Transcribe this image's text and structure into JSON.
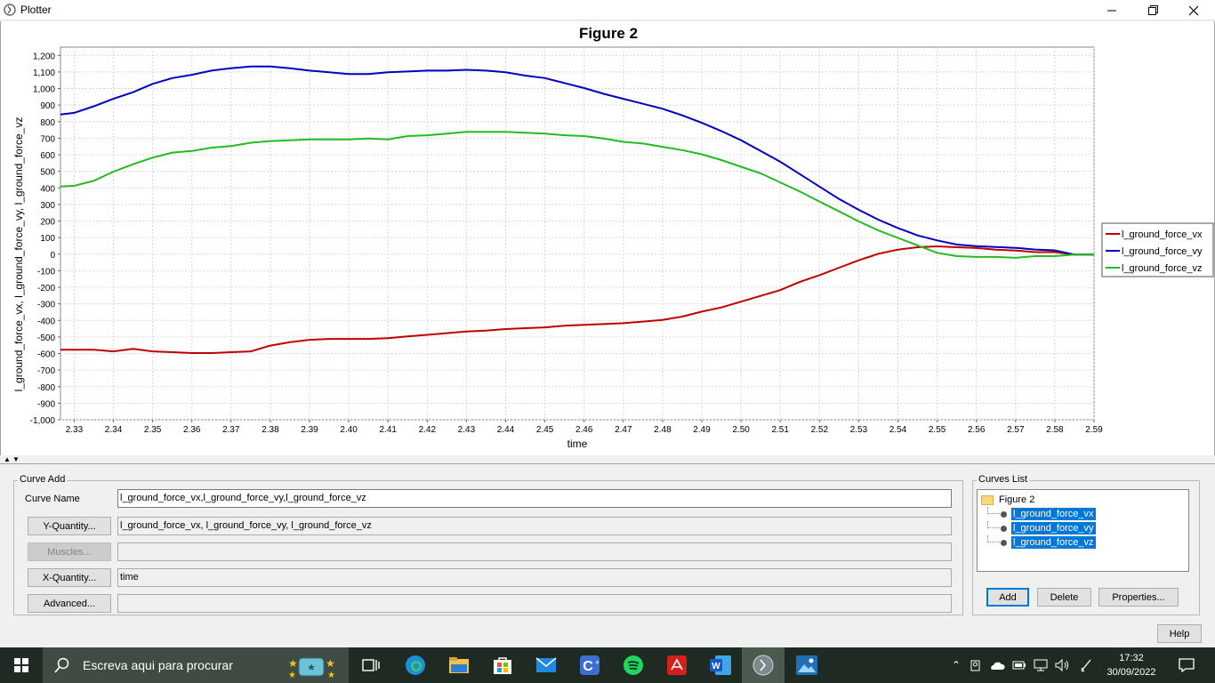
{
  "window": {
    "title": "Plotter"
  },
  "chart": {
    "title": "Figure 2",
    "xlabel": "time",
    "ylabel": "l_ground_force_vx, l_ground_force_vy, l_ground_force_vz",
    "legend": [
      "l_ground_force_vx",
      "l_ground_force_vy",
      "l_ground_force_vz"
    ],
    "colors": {
      "vx": "#c00000",
      "vy": "#0000c0",
      "vz": "#22bb22"
    }
  },
  "chart_data": {
    "type": "line",
    "title": "Figure 2",
    "xlabel": "time",
    "ylabel": "l_ground_force_vx, l_ground_force_vy, l_ground_force_vz",
    "xlim": [
      2.3265,
      2.59
    ],
    "ylim": [
      -1000,
      1250
    ],
    "grid": true,
    "legend_position": "right",
    "x_ticks": [
      "2.33",
      "2.34",
      "2.35",
      "2.36",
      "2.37",
      "2.38",
      "2.39",
      "2.40",
      "2.41",
      "2.42",
      "2.43",
      "2.44",
      "2.45",
      "2.46",
      "2.47",
      "2.48",
      "2.49",
      "2.50",
      "2.51",
      "2.52",
      "2.53",
      "2.54",
      "2.55",
      "2.56",
      "2.57",
      "2.58",
      "2.59"
    ],
    "y_ticks": [
      "1,200",
      "1,100",
      "1,000",
      "900",
      "800",
      "700",
      "600",
      "500",
      "400",
      "300",
      "200",
      "100",
      "0",
      "-100",
      "-200",
      "-300",
      "-400",
      "-500",
      "-600",
      "-700",
      "-800",
      "-900",
      "-1,000"
    ],
    "series": [
      {
        "name": "l_ground_force_vx",
        "color": "#c00000",
        "x": [
          2.3265,
          2.33,
          2.335,
          2.34,
          2.345,
          2.35,
          2.355,
          2.36,
          2.365,
          2.37,
          2.375,
          2.38,
          2.385,
          2.39,
          2.395,
          2.4,
          2.405,
          2.41,
          2.415,
          2.42,
          2.425,
          2.43,
          2.435,
          2.44,
          2.445,
          2.45,
          2.455,
          2.46,
          2.465,
          2.47,
          2.475,
          2.48,
          2.485,
          2.49,
          2.495,
          2.5,
          2.505,
          2.51,
          2.515,
          2.52,
          2.525,
          2.53,
          2.535,
          2.54,
          2.545,
          2.55,
          2.555,
          2.56,
          2.565,
          2.57,
          2.575,
          2.58,
          2.585,
          2.59
        ],
        "y": [
          -577,
          -577,
          -577,
          -587,
          -572,
          -587,
          -592,
          -597,
          -597,
          -592,
          -587,
          -552,
          -532,
          -517,
          -512,
          -512,
          -512,
          -507,
          -497,
          -487,
          -477,
          -467,
          -462,
          -452,
          -447,
          -442,
          -432,
          -427,
          -422,
          -417,
          -407,
          -397,
          -377,
          -347,
          -322,
          -287,
          -252,
          -217,
          -167,
          -127,
          -82,
          -37,
          2,
          27,
          42,
          47,
          42,
          37,
          27,
          22,
          12,
          12,
          -3,
          -3
        ]
      },
      {
        "name": "l_ground_force_vy",
        "color": "#0000c0",
        "x": [
          2.3265,
          2.33,
          2.335,
          2.34,
          2.345,
          2.35,
          2.355,
          2.36,
          2.365,
          2.37,
          2.375,
          2.38,
          2.385,
          2.39,
          2.395,
          2.4,
          2.405,
          2.41,
          2.415,
          2.42,
          2.425,
          2.43,
          2.435,
          2.44,
          2.445,
          2.45,
          2.455,
          2.46,
          2.465,
          2.47,
          2.475,
          2.48,
          2.485,
          2.49,
          2.495,
          2.5,
          2.505,
          2.51,
          2.515,
          2.52,
          2.525,
          2.53,
          2.535,
          2.54,
          2.545,
          2.55,
          2.555,
          2.56,
          2.565,
          2.57,
          2.575,
          2.58,
          2.585,
          2.59
        ],
        "y": [
          843,
          853,
          893,
          938,
          978,
          1028,
          1063,
          1083,
          1108,
          1123,
          1133,
          1133,
          1123,
          1108,
          1098,
          1088,
          1088,
          1098,
          1103,
          1108,
          1108,
          1113,
          1108,
          1098,
          1078,
          1063,
          1033,
          1003,
          968,
          938,
          908,
          878,
          838,
          793,
          743,
          688,
          623,
          558,
          483,
          408,
          333,
          268,
          208,
          158,
          113,
          83,
          58,
          48,
          43,
          38,
          28,
          23,
          -3,
          -3
        ]
      },
      {
        "name": "l_ground_force_vz",
        "color": "#22bb22",
        "x": [
          2.3265,
          2.33,
          2.335,
          2.34,
          2.345,
          2.35,
          2.355,
          2.36,
          2.365,
          2.37,
          2.375,
          2.38,
          2.385,
          2.39,
          2.395,
          2.4,
          2.405,
          2.41,
          2.415,
          2.42,
          2.425,
          2.43,
          2.435,
          2.44,
          2.445,
          2.45,
          2.455,
          2.46,
          2.465,
          2.47,
          2.475,
          2.48,
          2.485,
          2.49,
          2.495,
          2.5,
          2.505,
          2.51,
          2.515,
          2.52,
          2.525,
          2.53,
          2.535,
          2.54,
          2.545,
          2.55,
          2.555,
          2.56,
          2.565,
          2.57,
          2.575,
          2.58,
          2.585,
          2.59
        ],
        "y": [
          408,
          413,
          443,
          498,
          543,
          583,
          613,
          623,
          643,
          653,
          673,
          683,
          688,
          693,
          693,
          693,
          698,
          693,
          713,
          718,
          728,
          738,
          738,
          738,
          733,
          728,
          718,
          713,
          698,
          678,
          668,
          648,
          628,
          603,
          568,
          528,
          488,
          433,
          378,
          318,
          258,
          198,
          143,
          98,
          53,
          8,
          -12,
          -17,
          -17,
          -22,
          -12,
          -12,
          -2,
          -2
        ]
      }
    ]
  },
  "curve_add": {
    "group_title": "Curve Add",
    "curve_name_label": "Curve Name",
    "curve_name_value": "l_ground_force_vx,l_ground_force_vy,l_ground_force_vz",
    "y_quantity_button": "Y-Quantity...",
    "y_quantity_value": "l_ground_force_vx, l_ground_force_vy, l_ground_force_vz",
    "muscles_button": "Muscles...",
    "muscles_value": "",
    "x_quantity_button": "X-Quantity...",
    "x_quantity_value": "time",
    "advanced_button": "Advanced...",
    "advanced_value": ""
  },
  "curves_list": {
    "group_title": "Curves List",
    "root": "Figure 2",
    "items": [
      "l_ground_force_vx",
      "l_ground_force_vy",
      "l_ground_force_vz"
    ],
    "add_button": "Add",
    "delete_button": "Delete",
    "properties_button": "Properties..."
  },
  "help_button": "Help",
  "taskbar": {
    "search_placeholder": "Escreva aqui para procurar",
    "time": "17:32",
    "date": "30/09/2022",
    "icons": [
      "windows-start-icon",
      "search-icon",
      "cortana-tv-icon",
      "task-view-icon",
      "edge-icon",
      "file-explorer-icon",
      "store-icon",
      "mail-icon",
      "app-c-icon",
      "spotify-icon",
      "acrobat-icon",
      "word-icon",
      "opensim-icon",
      "photos-icon"
    ]
  }
}
